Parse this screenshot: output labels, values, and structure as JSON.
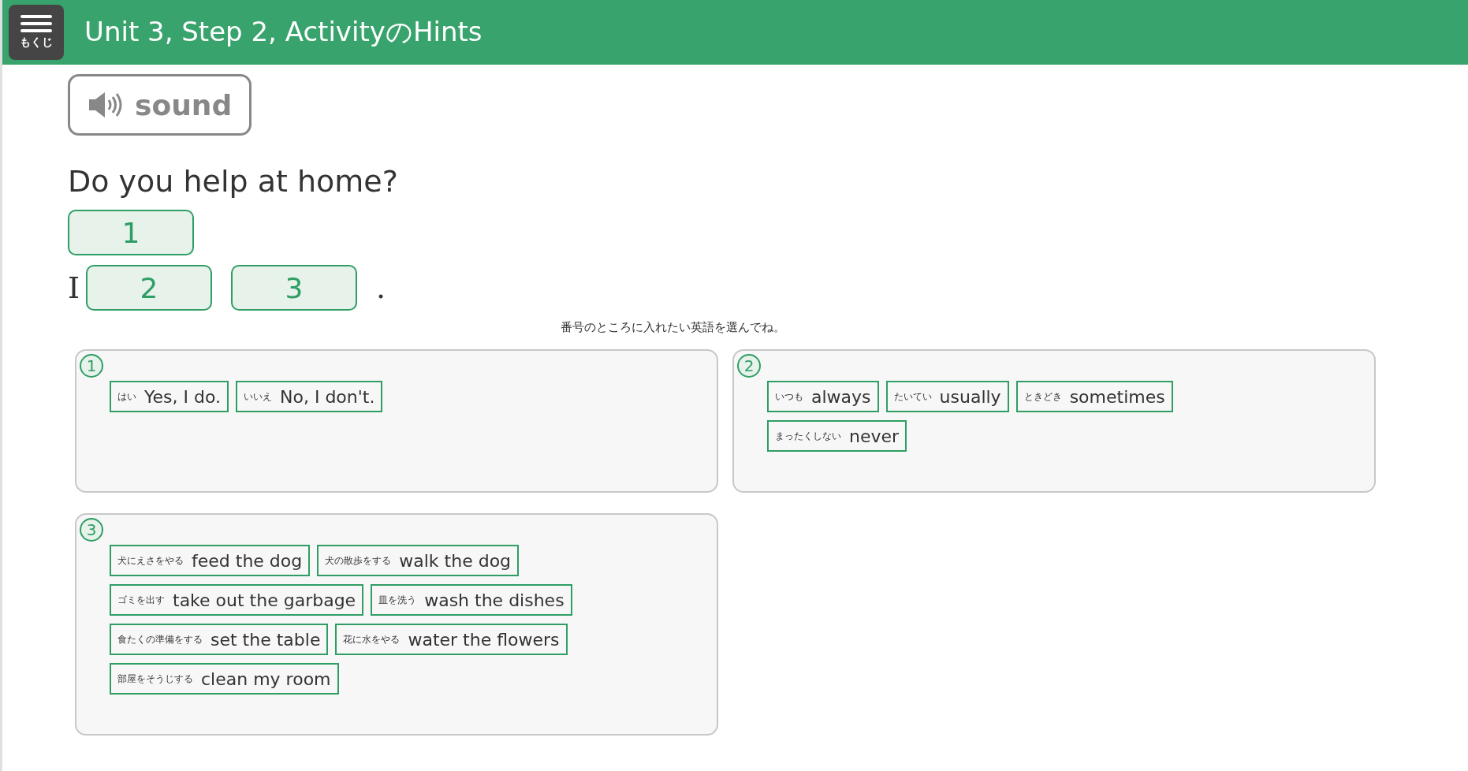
{
  "header": {
    "menu_label": "もくじ",
    "title": "Unit 3, Step 2, ActivityのHints"
  },
  "sound_button": {
    "label": "sound"
  },
  "question": "Do you help at home?",
  "answer_lines": [
    {
      "parts": [
        {
          "kind": "blank",
          "text": "1"
        }
      ]
    },
    {
      "parts": [
        {
          "kind": "word",
          "text": "I"
        },
        {
          "kind": "blank",
          "text": "2"
        },
        {
          "kind": "blank",
          "text": "3"
        },
        {
          "kind": "word",
          "text": "."
        }
      ]
    }
  ],
  "instruction": "番号のところに入れたい英語を選んでね。",
  "panels": [
    {
      "number": "1",
      "choices": [
        {
          "hint": "はい",
          "text": "Yes, I do."
        },
        {
          "hint": "いいえ",
          "text": "No, I don't."
        }
      ]
    },
    {
      "number": "2",
      "choices": [
        {
          "hint": "いつも",
          "text": "always"
        },
        {
          "hint": "たいてい",
          "text": "usually"
        },
        {
          "hint": "ときどき",
          "text": "sometimes"
        },
        {
          "hint": "まったくしない",
          "text": "never"
        }
      ]
    },
    {
      "number": "3",
      "choices": [
        {
          "hint": "犬にえさをやる",
          "text": "feed the dog"
        },
        {
          "hint": "犬の散歩をする",
          "text": "walk the dog"
        },
        {
          "hint": "ゴミを出す",
          "text": "take out the garbage"
        },
        {
          "hint": "皿を洗う",
          "text": "wash the dishes"
        },
        {
          "hint": "食たくの準備をする",
          "text": "set the table"
        },
        {
          "hint": "花に水をやる",
          "text": "water the flowers"
        },
        {
          "hint": "部屋をそうじする",
          "text": "clean my room"
        }
      ]
    }
  ]
}
